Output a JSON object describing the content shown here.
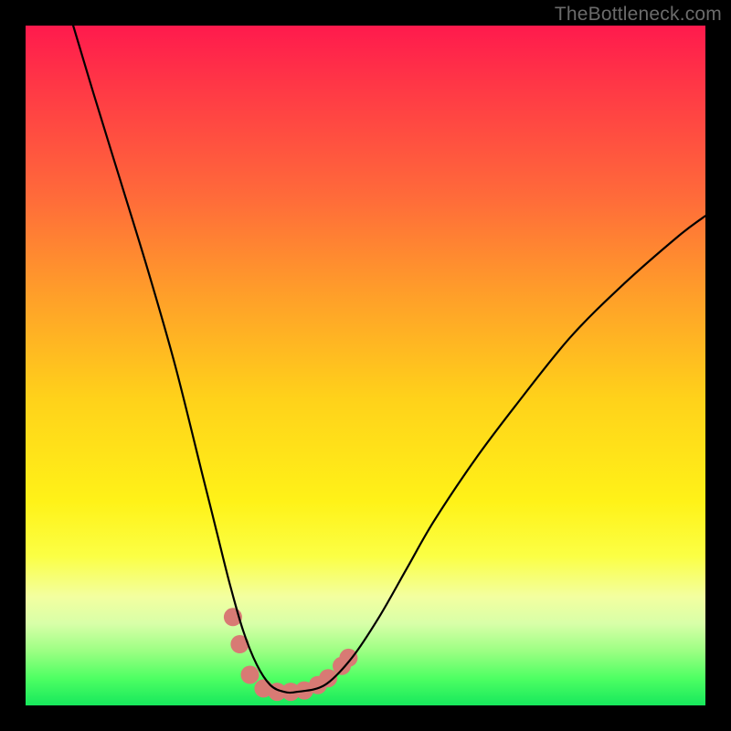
{
  "watermark": "TheBottleneck.com",
  "chart_data": {
    "type": "line",
    "title": "",
    "xlabel": "",
    "ylabel": "",
    "xlim": [
      0,
      100
    ],
    "ylim": [
      0,
      100
    ],
    "series": [
      {
        "name": "bottleneck-curve",
        "x": [
          7,
          10,
          14,
          18,
          22,
          26,
          28,
          30,
          32,
          34,
          36,
          38,
          40,
          44,
          48,
          52,
          56,
          60,
          66,
          72,
          80,
          88,
          96,
          100
        ],
        "values": [
          100,
          90,
          77,
          64,
          50,
          34,
          26,
          18,
          11,
          6,
          3,
          2,
          2,
          3,
          7,
          13,
          20,
          27,
          36,
          44,
          54,
          62,
          69,
          72
        ]
      }
    ],
    "markers": {
      "name": "highlight-points",
      "color": "#d87a74",
      "points": [
        {
          "x": 30.5,
          "y": 13
        },
        {
          "x": 31.5,
          "y": 9
        },
        {
          "x": 33,
          "y": 4.5
        },
        {
          "x": 35,
          "y": 2.5
        },
        {
          "x": 37,
          "y": 2.0
        },
        {
          "x": 39,
          "y": 2.0
        },
        {
          "x": 41,
          "y": 2.2
        },
        {
          "x": 43,
          "y": 3.0
        },
        {
          "x": 44.5,
          "y": 4.0
        },
        {
          "x": 46.5,
          "y": 5.8
        },
        {
          "x": 47.5,
          "y": 7.0
        }
      ]
    },
    "colors": {
      "curve": "#000000",
      "marker": "#d87a74",
      "gradient_top": "#ff1a4d",
      "gradient_bottom": "#17e85c"
    }
  }
}
